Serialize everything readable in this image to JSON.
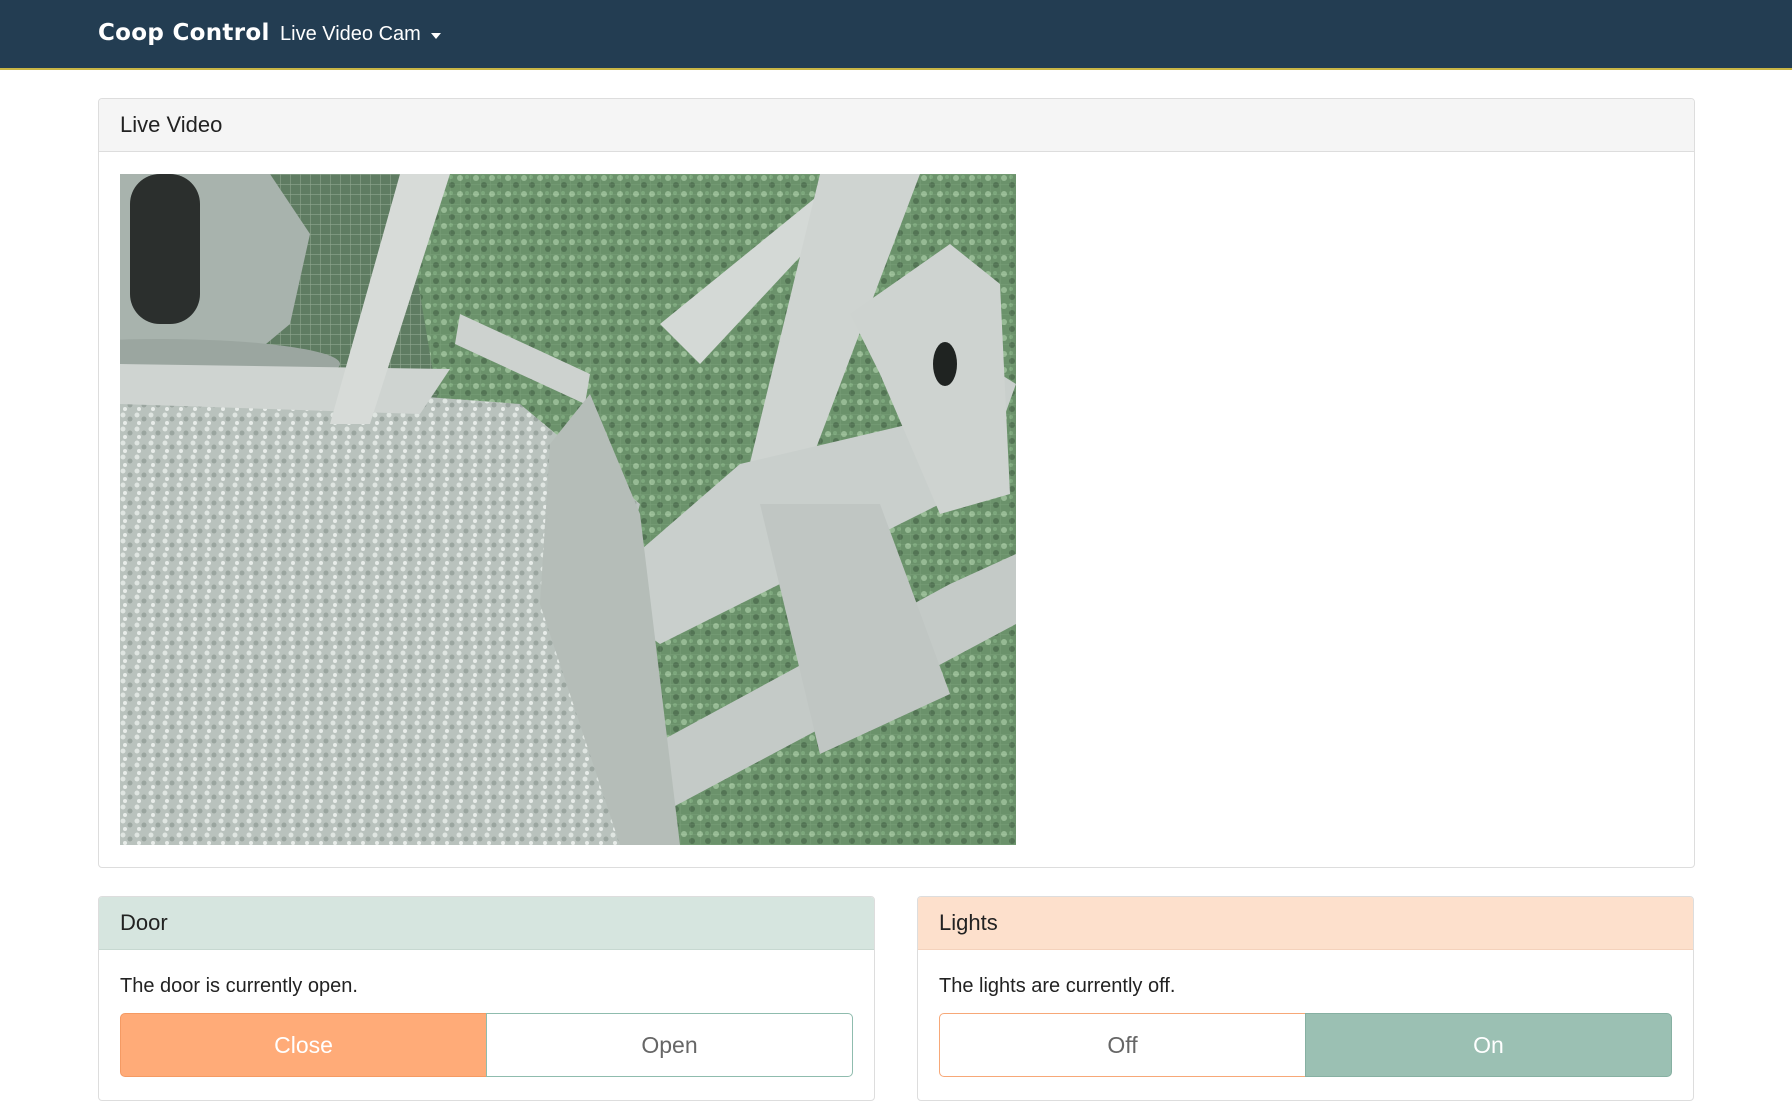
{
  "navbar": {
    "brand": "Coop Control",
    "dropdown_label": "Live Video Cam"
  },
  "video_panel": {
    "title": "Live Video"
  },
  "door_panel": {
    "title": "Door",
    "status_text": "The door is currently open.",
    "close_label": "Close",
    "open_label": "Open",
    "active_button": "Close"
  },
  "lights_panel": {
    "title": "Lights",
    "status_text": "The lights are currently off.",
    "off_label": "Off",
    "on_label": "On",
    "active_button": "On"
  },
  "colors": {
    "navbar_bg": "#233d52",
    "door_heading_bg": "#d6e5df",
    "lights_heading_bg": "#fde0cc",
    "orange_accent": "#ffab78",
    "green_accent": "#9bc0b3"
  }
}
